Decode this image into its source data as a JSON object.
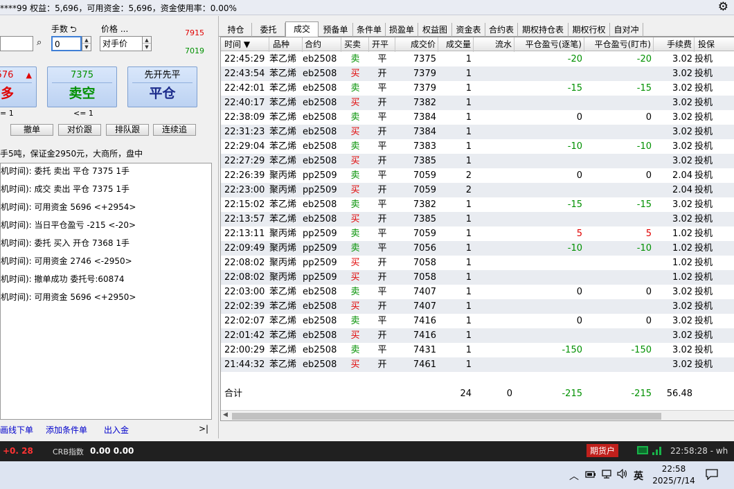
{
  "topbar": {
    "account_text": "****99  权益：5,696，可用资金：5,696，资金使用率：0.00%"
  },
  "order": {
    "qty_label": "手数",
    "qty_value": "0",
    "price_label": "价格 ...",
    "price_value": "对手价",
    "price_high": "7915",
    "price_low": "7019",
    "buy_price": "576",
    "buy_arrow": "▲",
    "buy_action": "多",
    "sell_price": "7375",
    "sell_action": "卖空",
    "close_price": "先开先平",
    "close_action": "平仓",
    "buy_limit": "= 1",
    "sell_limit": "<= 1",
    "buttons": [
      "撤单",
      "对价跟",
      "排队跟",
      "连续追"
    ],
    "info": "手5吨，保证金2950元，大商所，盘中"
  },
  "log": [
    "机时间):  委托  卖出  平仓  7375  1手",
    "机时间):  成交  卖出  平仓  7375  1手",
    "机时间):  可用资金  5696  <+2954>",
    "机时间):  当日平仓盈亏  -215  <-20>",
    "机时间):  委托  买入  开仓  7368  1手",
    "机时间):  可用资金  2746  <-2950>",
    "机时间):  撤单成功  委托号:60874",
    "机时间):  可用资金  5696  <+2950>"
  ],
  "links": [
    "画线下单",
    "添加条件单",
    "出入金",
    ">|"
  ],
  "tabs": [
    "持仓",
    "委托",
    "成交",
    "预备单",
    "条件单",
    "损盈单",
    "权益图",
    "资金表",
    "合约表",
    "期权持仓表",
    "期权行权",
    "自对冲"
  ],
  "active_tab": 2,
  "columns": [
    "时间 ▼",
    "品种",
    "合约",
    "买卖",
    "开平",
    "成交价",
    "成交量",
    "流水",
    "平仓盈亏(逐笔)",
    "平仓盈亏(盯市)",
    "手续费",
    "投保"
  ],
  "trades": [
    {
      "time": "22:45:29",
      "variety": "苯乙烯",
      "contract": "eb2508",
      "side": "卖",
      "oc": "平",
      "price": "7375",
      "qty": "1",
      "flow": "",
      "pnl_trade": "-20",
      "pnl_mtm": "-20",
      "fee": "3.02",
      "hedge": "投机"
    },
    {
      "time": "22:43:54",
      "variety": "苯乙烯",
      "contract": "eb2508",
      "side": "买",
      "oc": "开",
      "price": "7379",
      "qty": "1",
      "flow": "",
      "pnl_trade": "",
      "pnl_mtm": "",
      "fee": "3.02",
      "hedge": "投机"
    },
    {
      "time": "22:42:01",
      "variety": "苯乙烯",
      "contract": "eb2508",
      "side": "卖",
      "oc": "平",
      "price": "7379",
      "qty": "1",
      "flow": "",
      "pnl_trade": "-15",
      "pnl_mtm": "-15",
      "fee": "3.02",
      "hedge": "投机"
    },
    {
      "time": "22:40:17",
      "variety": "苯乙烯",
      "contract": "eb2508",
      "side": "买",
      "oc": "开",
      "price": "7382",
      "qty": "1",
      "flow": "",
      "pnl_trade": "",
      "pnl_mtm": "",
      "fee": "3.02",
      "hedge": "投机"
    },
    {
      "time": "22:38:09",
      "variety": "苯乙烯",
      "contract": "eb2508",
      "side": "卖",
      "oc": "平",
      "price": "7384",
      "qty": "1",
      "flow": "",
      "pnl_trade": "0",
      "pnl_mtm": "0",
      "fee": "3.02",
      "hedge": "投机"
    },
    {
      "time": "22:31:23",
      "variety": "苯乙烯",
      "contract": "eb2508",
      "side": "买",
      "oc": "开",
      "price": "7384",
      "qty": "1",
      "flow": "",
      "pnl_trade": "",
      "pnl_mtm": "",
      "fee": "3.02",
      "hedge": "投机"
    },
    {
      "time": "22:29:04",
      "variety": "苯乙烯",
      "contract": "eb2508",
      "side": "卖",
      "oc": "平",
      "price": "7383",
      "qty": "1",
      "flow": "",
      "pnl_trade": "-10",
      "pnl_mtm": "-10",
      "fee": "3.02",
      "hedge": "投机"
    },
    {
      "time": "22:27:29",
      "variety": "苯乙烯",
      "contract": "eb2508",
      "side": "买",
      "oc": "开",
      "price": "7385",
      "qty": "1",
      "flow": "",
      "pnl_trade": "",
      "pnl_mtm": "",
      "fee": "3.02",
      "hedge": "投机"
    },
    {
      "time": "22:26:39",
      "variety": "聚丙烯",
      "contract": "pp2509",
      "side": "卖",
      "oc": "平",
      "price": "7059",
      "qty": "2",
      "flow": "",
      "pnl_trade": "0",
      "pnl_mtm": "0",
      "fee": "2.04",
      "hedge": "投机"
    },
    {
      "time": "22:23:00",
      "variety": "聚丙烯",
      "contract": "pp2509",
      "side": "买",
      "oc": "开",
      "price": "7059",
      "qty": "2",
      "flow": "",
      "pnl_trade": "",
      "pnl_mtm": "",
      "fee": "2.04",
      "hedge": "投机"
    },
    {
      "time": "22:15:02",
      "variety": "苯乙烯",
      "contract": "eb2508",
      "side": "卖",
      "oc": "平",
      "price": "7382",
      "qty": "1",
      "flow": "",
      "pnl_trade": "-15",
      "pnl_mtm": "-15",
      "fee": "3.02",
      "hedge": "投机"
    },
    {
      "time": "22:13:57",
      "variety": "苯乙烯",
      "contract": "eb2508",
      "side": "买",
      "oc": "开",
      "price": "7385",
      "qty": "1",
      "flow": "",
      "pnl_trade": "",
      "pnl_mtm": "",
      "fee": "3.02",
      "hedge": "投机"
    },
    {
      "time": "22:13:11",
      "variety": "聚丙烯",
      "contract": "pp2509",
      "side": "卖",
      "oc": "平",
      "price": "7059",
      "qty": "1",
      "flow": "",
      "pnl_trade": "5",
      "pnl_mtm": "5",
      "fee": "1.02",
      "hedge": "投机"
    },
    {
      "time": "22:09:49",
      "variety": "聚丙烯",
      "contract": "pp2509",
      "side": "卖",
      "oc": "平",
      "price": "7056",
      "qty": "1",
      "flow": "",
      "pnl_trade": "-10",
      "pnl_mtm": "-10",
      "fee": "1.02",
      "hedge": "投机"
    },
    {
      "time": "22:08:02",
      "variety": "聚丙烯",
      "contract": "pp2509",
      "side": "买",
      "oc": "开",
      "price": "7058",
      "qty": "1",
      "flow": "",
      "pnl_trade": "",
      "pnl_mtm": "",
      "fee": "1.02",
      "hedge": "投机"
    },
    {
      "time": "22:08:02",
      "variety": "聚丙烯",
      "contract": "pp2509",
      "side": "买",
      "oc": "开",
      "price": "7058",
      "qty": "1",
      "flow": "",
      "pnl_trade": "",
      "pnl_mtm": "",
      "fee": "1.02",
      "hedge": "投机"
    },
    {
      "time": "22:03:00",
      "variety": "苯乙烯",
      "contract": "eb2508",
      "side": "卖",
      "oc": "平",
      "price": "7407",
      "qty": "1",
      "flow": "",
      "pnl_trade": "0",
      "pnl_mtm": "0",
      "fee": "3.02",
      "hedge": "投机"
    },
    {
      "time": "22:02:39",
      "variety": "苯乙烯",
      "contract": "eb2508",
      "side": "买",
      "oc": "开",
      "price": "7407",
      "qty": "1",
      "flow": "",
      "pnl_trade": "",
      "pnl_mtm": "",
      "fee": "3.02",
      "hedge": "投机"
    },
    {
      "time": "22:02:07",
      "variety": "苯乙烯",
      "contract": "eb2508",
      "side": "卖",
      "oc": "平",
      "price": "7416",
      "qty": "1",
      "flow": "",
      "pnl_trade": "0",
      "pnl_mtm": "0",
      "fee": "3.02",
      "hedge": "投机"
    },
    {
      "time": "22:01:42",
      "variety": "苯乙烯",
      "contract": "eb2508",
      "side": "买",
      "oc": "开",
      "price": "7416",
      "qty": "1",
      "flow": "",
      "pnl_trade": "",
      "pnl_mtm": "",
      "fee": "3.02",
      "hedge": "投机"
    },
    {
      "time": "22:00:29",
      "variety": "苯乙烯",
      "contract": "eb2508",
      "side": "卖",
      "oc": "平",
      "price": "7431",
      "qty": "1",
      "flow": "",
      "pnl_trade": "-150",
      "pnl_mtm": "-150",
      "fee": "3.02",
      "hedge": "投机"
    },
    {
      "time": "21:44:32",
      "variety": "苯乙烯",
      "contract": "eb2508",
      "side": "买",
      "oc": "开",
      "price": "7461",
      "qty": "1",
      "flow": "",
      "pnl_trade": "",
      "pnl_mtm": "",
      "fee": "3.02",
      "hedge": "投机"
    }
  ],
  "totals": {
    "label": "合计",
    "qty": "24",
    "flow": "0",
    "pnl_trade": "-215",
    "pnl_mtm": "-215",
    "fee": "56.48"
  },
  "colors": {
    "buy": "#e00000",
    "sell": "#009000",
    "up": "#e00000",
    "down": "#009000"
  },
  "status": {
    "change": "+0. 28",
    "crb_label": "CRB指数",
    "crb_value": "0.00  0.00",
    "account_type": "期货户",
    "time_text": "22:58:28 - wh"
  },
  "taskbar": {
    "ime": "英",
    "time": "22:58",
    "date": "2025/7/14",
    "icons": [
      "chevron-up-icon",
      "battery-icon",
      "network-icon",
      "volume-icon",
      "notification-icon"
    ]
  }
}
